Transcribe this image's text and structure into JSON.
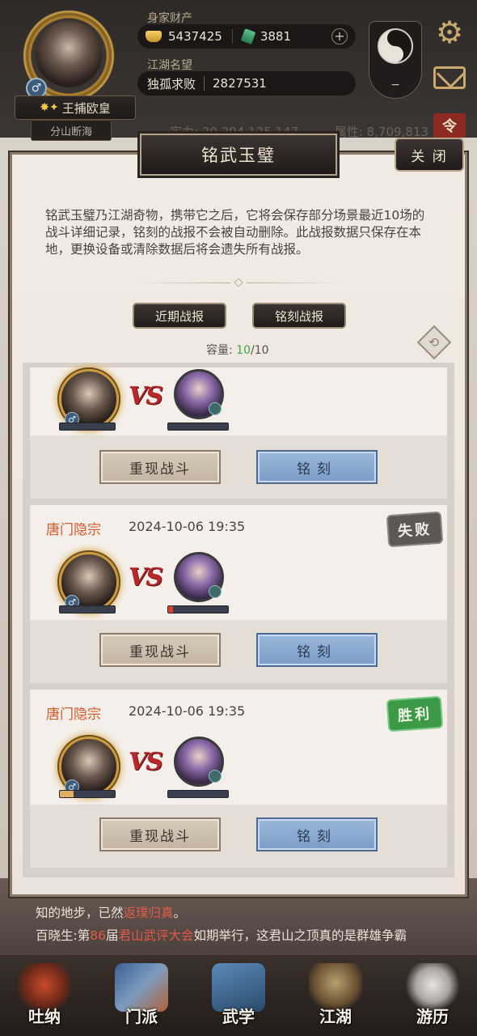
{
  "header": {
    "title_badge": "王捕欧皇",
    "sub_title": "分山断海",
    "wealth_label": "身家财产",
    "gold": "5437425",
    "jade": "3881",
    "fame_label": "江湖名望",
    "fame_title": "独孤求败",
    "fame_value": "2827531",
    "ling_tag": "令",
    "stat_left": "实力: 20,294,125,147",
    "stat_right": "属性: 8,709,813"
  },
  "modal": {
    "title": "铭武玉璧",
    "close_label": "关 闭",
    "description": "铭武玉璧乃江湖奇物，携带它之后，它将会保存部分场景最近10场的战斗详细记录，铭刻的战报不会被自动删除。此战报数据只保存在本地，更换设备或清除数据后将会遗失所有战报。",
    "tabs": [
      "近期战报",
      "铭刻战报"
    ],
    "capacity_label": "容量: ",
    "capacity_used": "10",
    "capacity_total": "/10"
  },
  "records": [
    {
      "school": "",
      "time": "",
      "result": "",
      "hp_self": 0,
      "hp_enemy": 0,
      "replay_label": "重现战斗",
      "engrave_label": "铭刻"
    },
    {
      "school": "唐门隐宗",
      "time": "2024-10-06 19:35",
      "result": "失败",
      "hp_self": 0,
      "hp_enemy": 0.08,
      "replay_label": "重现战斗",
      "engrave_label": "铭刻"
    },
    {
      "school": "唐门隐宗",
      "time": "2024-10-06 19:35",
      "result": "胜利",
      "hp_self": 0.25,
      "hp_enemy": 0,
      "replay_label": "重现战斗",
      "engrave_label": "铭刻"
    }
  ],
  "news": {
    "line1_start": "知的地步，已然",
    "line1_highlight": "返璞归真",
    "line1_end": "。",
    "line2_start": "百晓生:第",
    "line2_num": "86",
    "line2_mid": "届",
    "line2_highlight": "君山武评大会",
    "line2_end": "如期举行，这君山之顶真的是群雄争霸"
  },
  "nav": [
    "吐纳",
    "门派",
    "武学",
    "江湖",
    "游历"
  ],
  "colors": {
    "accent_red": "#b8282a",
    "school_orange": "#d25a2a",
    "capacity_green": "#3aa84a",
    "win_green": "#3c9a46",
    "lose_gray": "#5c5856",
    "engrave_blue": "#7c9cc6"
  }
}
